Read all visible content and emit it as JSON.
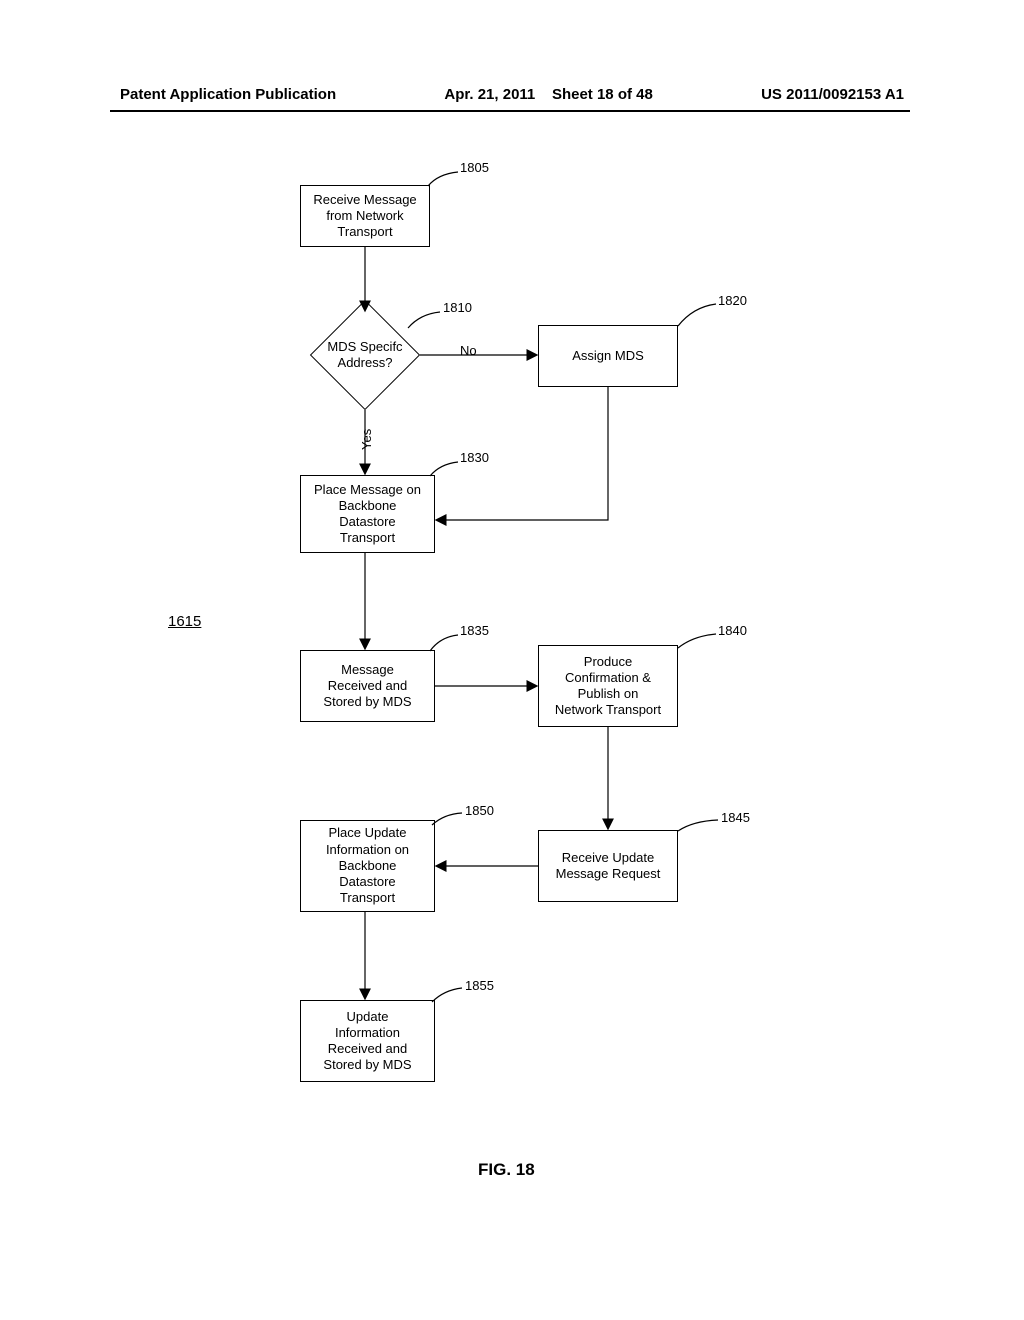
{
  "header": {
    "pub_label": "Patent Application Publication",
    "date": "Apr. 21, 2011",
    "sheet": "Sheet 18 of 48",
    "pub_number": "US 2011/0092153 A1"
  },
  "figure_ref": "1615",
  "figure_caption": "FIG. 18",
  "boxes": {
    "b1805": {
      "text": "Receive Message\nfrom Network\nTransport",
      "ref": "1805"
    },
    "d1810": {
      "text": "MDS Specifc\nAddress?",
      "ref": "1810"
    },
    "b1820": {
      "text": "Assign MDS",
      "ref": "1820"
    },
    "b1830": {
      "text": "Place Message on\nBackbone\nDatastore\nTransport",
      "ref": "1830"
    },
    "b1835": {
      "text": "Message\nReceived and\nStored by MDS",
      "ref": "1835"
    },
    "b1840": {
      "text": "Produce\nConfirmation &\nPublish on\nNetwork Transport",
      "ref": "1840"
    },
    "b1845": {
      "text": "Receive Update\nMessage Request",
      "ref": "1845"
    },
    "b1850": {
      "text": "Place Update\nInformation on\nBackbone\nDatastore\nTransport",
      "ref": "1850"
    },
    "b1855": {
      "text": "Update\nInformation\nReceived and\nStored by MDS",
      "ref": "1855"
    }
  },
  "edges": {
    "no": "No",
    "yes": "Yes"
  }
}
